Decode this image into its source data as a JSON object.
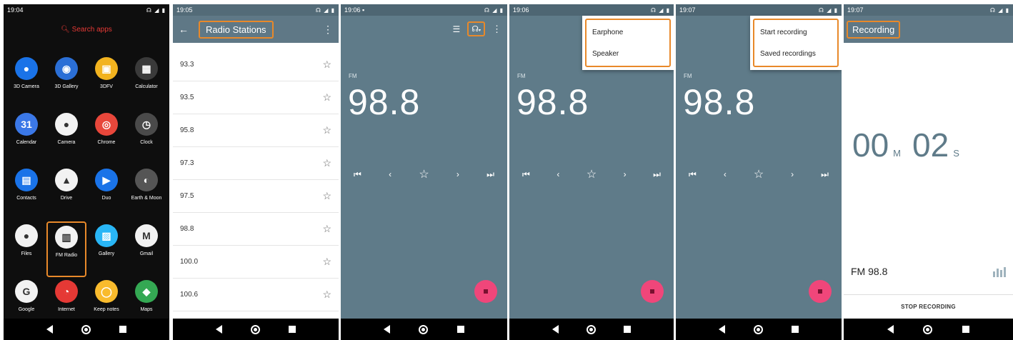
{
  "panel1": {
    "time": "19:04",
    "status": "☊ ◢ ▮",
    "search": "Search apps",
    "apps": [
      {
        "label": "3D Camera",
        "bg": "#1a73e8",
        "glyph": "●"
      },
      {
        "label": "3D Gallery",
        "bg": "#2b6fd6",
        "glyph": "◉"
      },
      {
        "label": "3DFV",
        "bg": "#f2b31f",
        "glyph": "▣"
      },
      {
        "label": "Calculator",
        "bg": "#3a3a3a",
        "glyph": "▦"
      },
      {
        "label": "Calendar",
        "bg": "#3b78e7",
        "glyph": "31"
      },
      {
        "label": "Camera",
        "bg": "#f2f2f2",
        "glyph": "●"
      },
      {
        "label": "Chrome",
        "bg": "#e8473b",
        "glyph": "◎"
      },
      {
        "label": "Clock",
        "bg": "#4a4a4a",
        "glyph": "◷"
      },
      {
        "label": "Contacts",
        "bg": "#1a73e8",
        "glyph": "▤"
      },
      {
        "label": "Drive",
        "bg": "#f2f2f2",
        "glyph": "▲"
      },
      {
        "label": "Duo",
        "bg": "#1a73e8",
        "glyph": "▶"
      },
      {
        "label": "Earth & Moon",
        "bg": "#555",
        "glyph": "◐"
      },
      {
        "label": "Files",
        "bg": "#f2f2f2",
        "glyph": "●"
      },
      {
        "label": "FM Radio",
        "bg": "#f2f2f2",
        "glyph": "▥"
      },
      {
        "label": "Gallery",
        "bg": "#29b6f6",
        "glyph": "▨"
      },
      {
        "label": "Gmail",
        "bg": "#f2f2f2",
        "glyph": "M"
      },
      {
        "label": "Google",
        "bg": "#f2f2f2",
        "glyph": "G"
      },
      {
        "label": "Internet",
        "bg": "#e53935",
        "glyph": "◔"
      },
      {
        "label": "Keep notes",
        "bg": "#f9bb2d",
        "glyph": "◯"
      },
      {
        "label": "Maps",
        "bg": "#34a853",
        "glyph": "◆"
      }
    ]
  },
  "panel2": {
    "time": "19:05",
    "status": "☊ ◢ ▮",
    "back": "←",
    "title": "Radio Stations",
    "menu": "⋮",
    "stations": [
      "93.3",
      "93.5",
      "95.8",
      "97.3",
      "97.5",
      "98.8",
      "100.0",
      "100.6"
    ],
    "star": "☆"
  },
  "panel3": {
    "time": "19:06",
    "status": "☊ ◢ ▮",
    "band": "FM",
    "freq": "98.8",
    "list_icon": "☰",
    "headset": "☊",
    "menu": "⋮"
  },
  "panel4": {
    "time": "19:06",
    "status": "☊ ◢ ▮",
    "band": "FM",
    "freq": "98.8",
    "menu_items": [
      "Earphone",
      "Speaker"
    ]
  },
  "panel5": {
    "time": "19:07",
    "status": "☊ ◢ ▮",
    "band": "FM",
    "freq": "98.8",
    "menu_items": [
      "Start recording",
      "Saved recordings"
    ]
  },
  "controls": {
    "prev": "⏮",
    "left": "‹",
    "star": "☆",
    "right": "›",
    "next": "⏭"
  },
  "panel6": {
    "time": "19:07",
    "status": "☊ ◢ ▮",
    "title": "Recording",
    "minutes": "00",
    "m": "M",
    "seconds": "02",
    "s": "S",
    "station": "FM 98.8",
    "stop": "STOP RECORDING"
  }
}
